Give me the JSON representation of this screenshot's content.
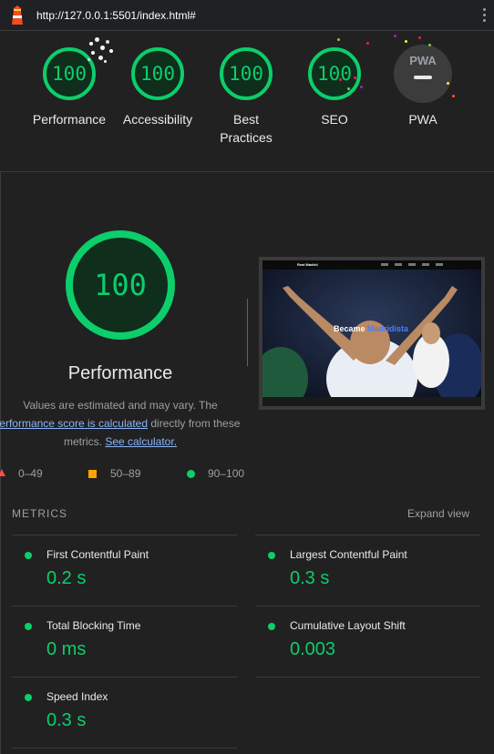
{
  "toolbar": {
    "url": "http://127.0.0.1:5501/index.html#"
  },
  "gauges": [
    {
      "label": "Performance",
      "score": "100"
    },
    {
      "label": "Accessibility",
      "score": "100"
    },
    {
      "label": "Best Practices",
      "score": "100"
    },
    {
      "label": "SEO",
      "score": "100"
    },
    {
      "label": "PWA",
      "badge": "PWA"
    }
  ],
  "performance": {
    "score": "100",
    "title": "Performance",
    "note_line1": "Values are estimated and may vary. The",
    "note_link1": "performance score is calculated",
    "note_mid": " directly from these",
    "note_line3": "metrics. ",
    "note_link2": "See calculator."
  },
  "screenshot": {
    "brand": "Real Madrid",
    "heading_a": "Became ",
    "heading_b": "Madridista"
  },
  "legend": {
    "fail": "0–49",
    "average": "50–89",
    "pass": "90–100"
  },
  "metrics": {
    "title": "METRICS",
    "expand": "Expand view",
    "items": [
      {
        "label": "First Contentful Paint",
        "value": "0.2 s"
      },
      {
        "label": "Largest Contentful Paint",
        "value": "0.3 s"
      },
      {
        "label": "Total Blocking Time",
        "value": "0 ms"
      },
      {
        "label": "Cumulative Layout Shift",
        "value": "0.003"
      },
      {
        "label": "Speed Index",
        "value": "0.3 s"
      }
    ]
  },
  "colors": {
    "pass": "#0cce6b",
    "average": "#ffa400",
    "fail": "#ff4e42",
    "link": "#8ab4f8"
  }
}
